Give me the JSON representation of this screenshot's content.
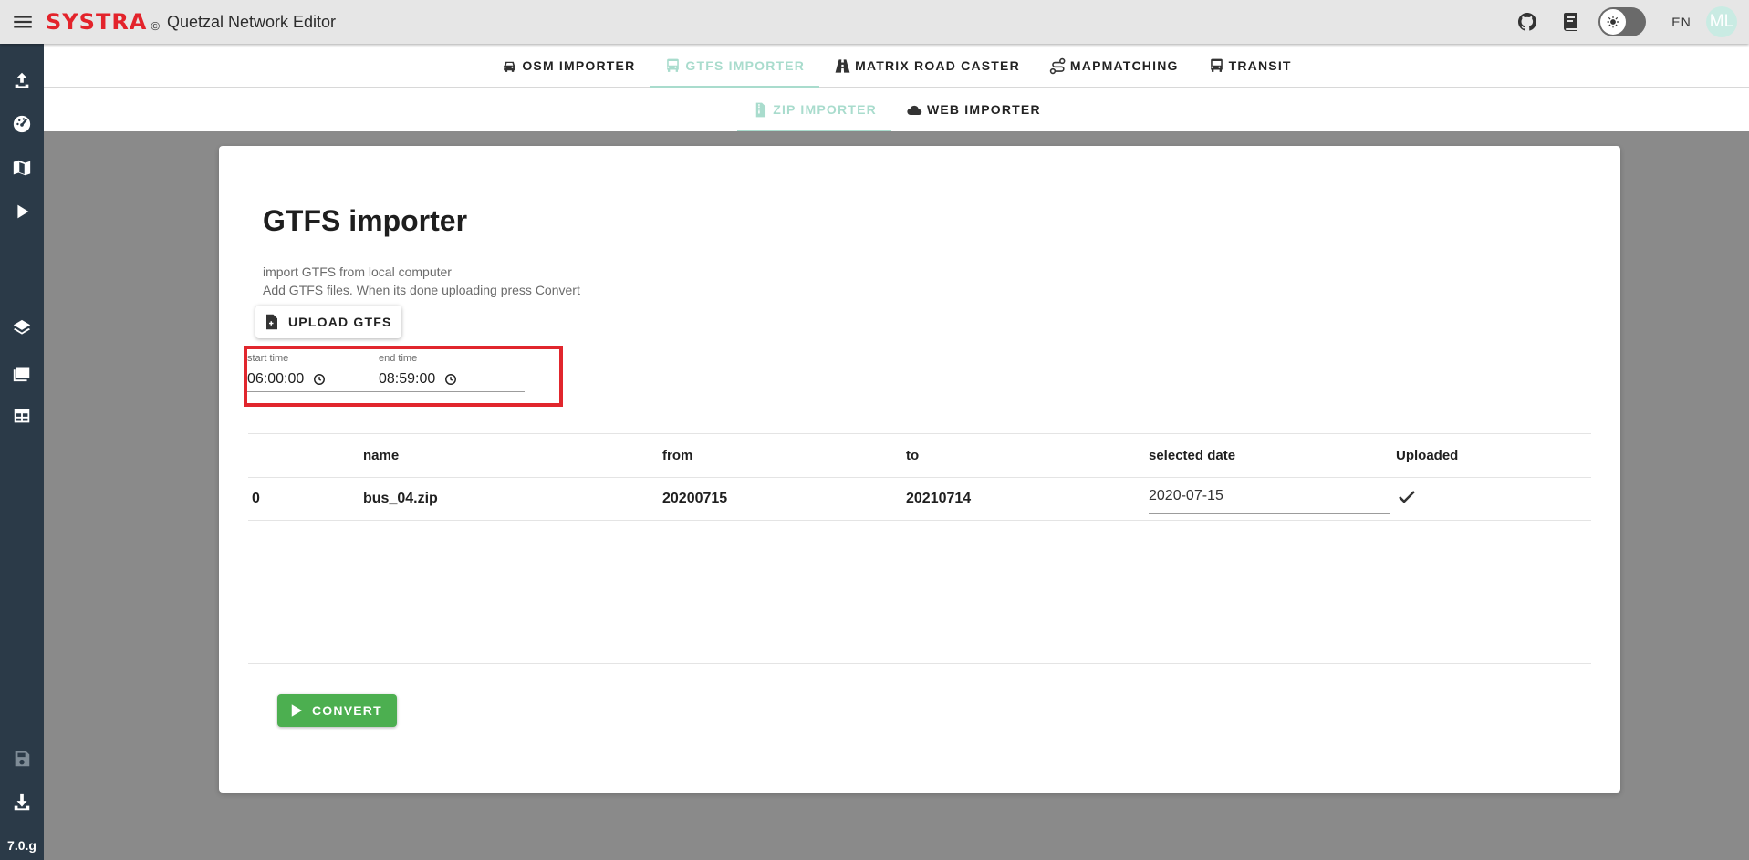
{
  "appbar": {
    "logo": "SYSTRA",
    "copyright": "©",
    "title": "Quetzal Network Editor",
    "language": "EN",
    "avatar_initials": "ML"
  },
  "rail": {
    "version": "7.0.g",
    "items": [
      "upload-icon",
      "dashboard-icon",
      "map-icon",
      "play-icon",
      "layers-icon",
      "images-icon",
      "table-icon",
      "save-icon",
      "download-icon"
    ]
  },
  "tabs": [
    {
      "label": "OSM IMPORTER",
      "icon": "car-icon",
      "active": false
    },
    {
      "label": "GTFS IMPORTER",
      "icon": "bus-icon",
      "active": true
    },
    {
      "label": "MATRIX ROAD CASTER",
      "icon": "road-icon",
      "active": false
    },
    {
      "label": "MAPMATCHING",
      "icon": "route-icon",
      "active": false
    },
    {
      "label": "TRANSIT",
      "icon": "transit-icon",
      "active": false
    }
  ],
  "subtabs": [
    {
      "label": "ZIP IMPORTER",
      "icon": "zip-file-icon",
      "active": true
    },
    {
      "label": "WEB IMPORTER",
      "icon": "cloud-icon",
      "active": false
    }
  ],
  "card": {
    "title": "GTFS importer",
    "subtitle_line1": "import GTFS from local computer",
    "subtitle_line2": "Add GTFS files. When its done uploading press Convert",
    "upload_label": "UPLOAD GTFS",
    "start_time_label": "start time",
    "start_time_value": "06:00:00",
    "end_time_label": "end time",
    "end_time_value": "08:59:00",
    "convert_label": "CONVERT"
  },
  "table": {
    "headers": [
      "",
      "name",
      "from",
      "to",
      "selected date",
      "Uploaded"
    ],
    "rows": [
      {
        "index": "0",
        "name": "bus_04.zip",
        "from": "20200715",
        "to": "20210714",
        "selected_date": "2020-07-15",
        "uploaded": true
      }
    ]
  },
  "colors": {
    "accent": "#a9dccd",
    "convert": "#4caf50",
    "highlight": "#e1262d",
    "rail": "#2b3a48"
  }
}
